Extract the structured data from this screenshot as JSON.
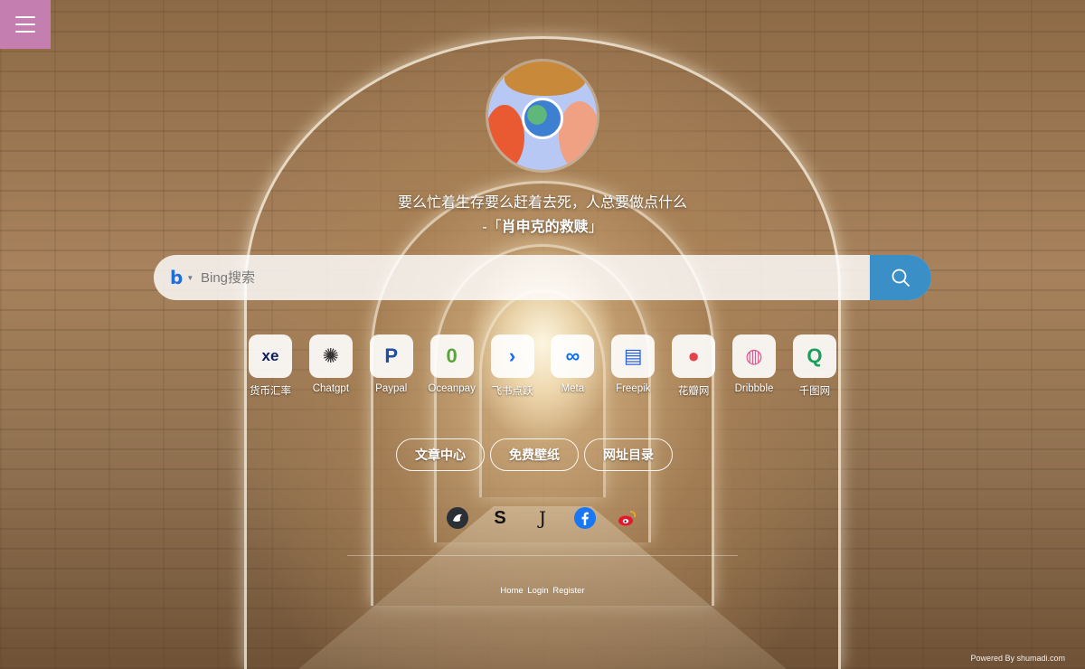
{
  "quote": {
    "line1": "要么忙着生存要么赶着去死，人总要做点什么",
    "prefix": "-「",
    "source": "肖申克的救赎",
    "suffix": "」"
  },
  "search": {
    "engine_icon": "bing-icon",
    "placeholder": "Bing搜索",
    "button_icon": "search-icon"
  },
  "shortcuts": [
    {
      "label": "货币汇率",
      "icon": "xe-icon",
      "glyph": "xe",
      "color": "#0a1f5c"
    },
    {
      "label": "Chatgpt",
      "icon": "chatgpt-icon",
      "glyph": "✺",
      "color": "#333333"
    },
    {
      "label": "Paypal",
      "icon": "paypal-icon",
      "glyph": "P",
      "color": "#1e4fa3"
    },
    {
      "label": "Oceanpay",
      "icon": "oceanpay-icon",
      "glyph": "0",
      "color": "#5aa53a"
    },
    {
      "label": "飞书点跃",
      "icon": "feishu-icon",
      "glyph": "›",
      "color": "#1f66f0"
    },
    {
      "label": "Meta",
      "icon": "meta-icon",
      "glyph": "∞",
      "color": "#0c6ef5"
    },
    {
      "label": "Freepik",
      "icon": "freepik-icon",
      "glyph": "▤",
      "color": "#2a63e0"
    },
    {
      "label": "花瓣网",
      "icon": "huaban-icon",
      "glyph": "●",
      "color": "#e5424d"
    },
    {
      "label": "Dribbble",
      "icon": "dribbble-icon",
      "glyph": "◍",
      "color": "#e05a96"
    },
    {
      "label": "千图网",
      "icon": "qiantu-icon",
      "glyph": "Q",
      "color": "#1aa05a"
    }
  ],
  "nav": [
    {
      "label": "文章中心"
    },
    {
      "label": "免费壁纸"
    },
    {
      "label": "网址目录"
    }
  ],
  "social": [
    {
      "icon": "bird-avatar-icon"
    },
    {
      "icon": "s-logo-icon",
      "glyph": "S"
    },
    {
      "icon": "j-logo-icon",
      "glyph": "J"
    },
    {
      "icon": "facebook-icon"
    },
    {
      "icon": "weibo-icon"
    }
  ],
  "footer": {
    "home": "Home",
    "login": "Login",
    "register": "Register",
    "powered": "Powered By shumadi.com"
  }
}
